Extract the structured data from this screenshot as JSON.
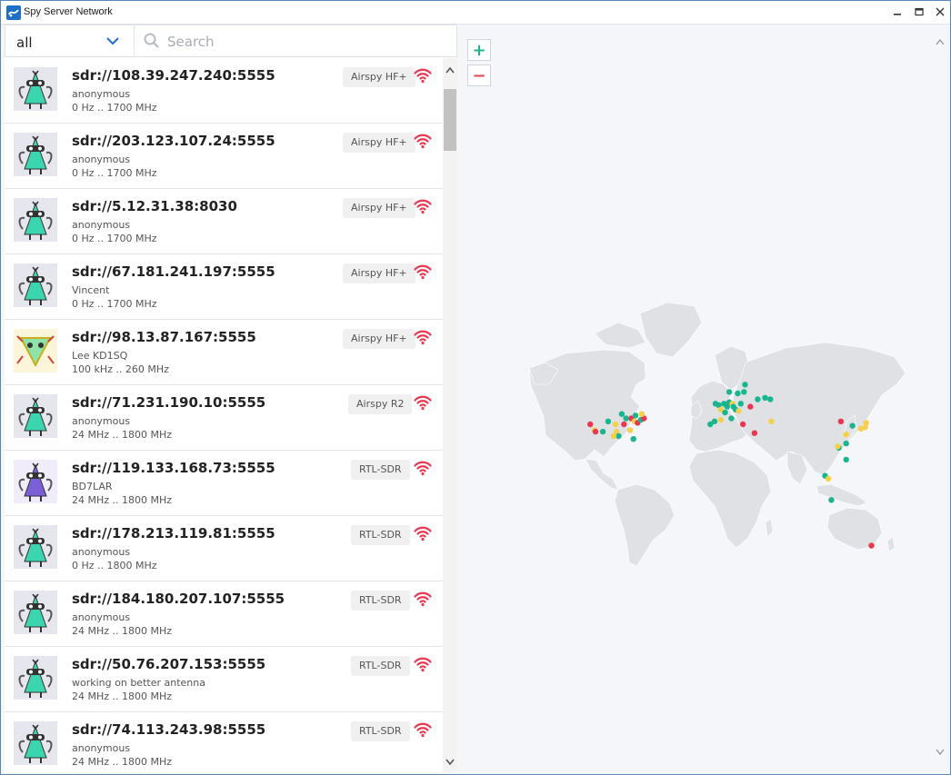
{
  "window": {
    "title": "Spy Server Network"
  },
  "filter": {
    "selected": "all",
    "search_placeholder": "Search",
    "search_value": ""
  },
  "colors": {
    "accent_teal": "#19b58e",
    "alert_red": "#e54855",
    "signal_red": "#e8384f",
    "yellow": "#f5d04a"
  },
  "servers": [
    {
      "address": "sdr://108.39.247.240:5555",
      "user": "anonymous",
      "range": "0 Hz .. 1700 MHz",
      "device": "Airspy HF+",
      "avatar": "robot-green"
    },
    {
      "address": "sdr://203.123.107.24:5555",
      "user": "anonymous",
      "range": "0 Hz .. 1700 MHz",
      "device": "Airspy HF+",
      "avatar": "robot-green"
    },
    {
      "address": "sdr://5.12.31.38:8030",
      "user": "anonymous",
      "range": "0 Hz .. 1700 MHz",
      "device": "Airspy HF+",
      "avatar": "robot-green"
    },
    {
      "address": "sdr://67.181.241.197:5555",
      "user": "Vincent",
      "range": "0 Hz .. 1700 MHz",
      "device": "Airspy HF+",
      "avatar": "robot-green"
    },
    {
      "address": "sdr://98.13.87.167:5555",
      "user": "Lee KD1SQ",
      "range": "100 kHz .. 260 MHz",
      "device": "Airspy HF+",
      "avatar": "triangle-yellow"
    },
    {
      "address": "sdr://71.231.190.10:5555",
      "user": "anonymous",
      "range": "24 MHz .. 1800 MHz",
      "device": "Airspy R2",
      "avatar": "robot-green"
    },
    {
      "address": "sdr://119.133.168.73:5555",
      "user": "BD7LAR",
      "range": "24 MHz .. 1800 MHz",
      "device": "RTL-SDR",
      "avatar": "robot-purple"
    },
    {
      "address": "sdr://178.213.119.81:5555",
      "user": "anonymous",
      "range": "0 Hz .. 1800 MHz",
      "device": "RTL-SDR",
      "avatar": "robot-green"
    },
    {
      "address": "sdr://184.180.207.107:5555",
      "user": "anonymous",
      "range": "24 MHz .. 1800 MHz",
      "device": "RTL-SDR",
      "avatar": "robot-green"
    },
    {
      "address": "sdr://50.76.207.153:5555",
      "user": "working on better antenna",
      "range": "24 MHz .. 1800 MHz",
      "device": "RTL-SDR",
      "avatar": "robot-green"
    },
    {
      "address": "sdr://74.113.243.98:5555",
      "user": "anonymous",
      "range": "24 MHz .. 1800 MHz",
      "device": "RTL-SDR",
      "avatar": "robot-green"
    }
  ],
  "map": {
    "zoom_in": "+",
    "zoom_out": "−",
    "markers": [
      {
        "lon": -122,
        "lat": 38,
        "c": "red"
      },
      {
        "lon": -118,
        "lat": 34,
        "c": "yellow"
      },
      {
        "lon": -117,
        "lat": 33,
        "c": "red"
      },
      {
        "lon": -110,
        "lat": 33,
        "c": "teal"
      },
      {
        "lon": -105,
        "lat": 40,
        "c": "teal"
      },
      {
        "lon": -97,
        "lat": 33,
        "c": "yellow"
      },
      {
        "lon": -95,
        "lat": 30,
        "c": "teal"
      },
      {
        "lon": -98,
        "lat": 38,
        "c": "yellow"
      },
      {
        "lon": -90,
        "lat": 38,
        "c": "red"
      },
      {
        "lon": -88,
        "lat": 42,
        "c": "teal"
      },
      {
        "lon": -84,
        "lat": 34,
        "c": "yellow"
      },
      {
        "lon": -83,
        "lat": 42,
        "c": "red"
      },
      {
        "lon": -80,
        "lat": 40,
        "c": "yellow"
      },
      {
        "lon": -77,
        "lat": 39,
        "c": "red"
      },
      {
        "lon": -74,
        "lat": 41,
        "c": "teal"
      },
      {
        "lon": -71,
        "lat": 42,
        "c": "red"
      },
      {
        "lon": -73,
        "lat": 45,
        "c": "yellow"
      },
      {
        "lon": -79,
        "lat": 44,
        "c": "teal"
      },
      {
        "lon": -92,
        "lat": 45,
        "c": "teal"
      },
      {
        "lon": -100,
        "lat": 30,
        "c": "yellow"
      },
      {
        "lon": -81,
        "lat": 28,
        "c": "teal"
      },
      {
        "lon": -3,
        "lat": 52,
        "c": "teal"
      },
      {
        "lon": 0,
        "lat": 51,
        "c": "teal"
      },
      {
        "lon": -4,
        "lat": 40,
        "c": "teal"
      },
      {
        "lon": 2,
        "lat": 48,
        "c": "yellow"
      },
      {
        "lon": 5,
        "lat": 52,
        "c": "teal"
      },
      {
        "lon": 8,
        "lat": 50,
        "c": "teal"
      },
      {
        "lon": 10,
        "lat": 53,
        "c": "teal"
      },
      {
        "lon": 13,
        "lat": 52,
        "c": "yellow"
      },
      {
        "lon": 14,
        "lat": 50,
        "c": "teal"
      },
      {
        "lon": 16,
        "lat": 48,
        "c": "teal"
      },
      {
        "lon": 19,
        "lat": 47,
        "c": "yellow"
      },
      {
        "lon": 21,
        "lat": 52,
        "c": "teal"
      },
      {
        "lon": 12,
        "lat": 42,
        "c": "teal"
      },
      {
        "lon": 23,
        "lat": 38,
        "c": "red"
      },
      {
        "lon": 18,
        "lat": 59,
        "c": "teal"
      },
      {
        "lon": 24,
        "lat": 60,
        "c": "teal"
      },
      {
        "lon": 10,
        "lat": 60,
        "c": "teal"
      },
      {
        "lon": 25,
        "lat": 65,
        "c": "teal"
      },
      {
        "lon": 30,
        "lat": 50,
        "c": "red"
      },
      {
        "lon": 37,
        "lat": 55,
        "c": "teal"
      },
      {
        "lon": 49,
        "lat": 55,
        "c": "teal"
      },
      {
        "lon": 44,
        "lat": 56,
        "c": "teal"
      },
      {
        "lon": 6,
        "lat": 46,
        "c": "teal"
      },
      {
        "lon": -8,
        "lat": 38,
        "c": "teal"
      },
      {
        "lon": 34,
        "lat": 32,
        "c": "red"
      },
      {
        "lon": 50,
        "lat": 40,
        "c": "yellow"
      },
      {
        "lon": 2,
        "lat": 41,
        "c": "yellow"
      },
      {
        "lon": 116,
        "lat": 40,
        "c": "red"
      },
      {
        "lon": 121,
        "lat": 31,
        "c": "yellow"
      },
      {
        "lon": 114,
        "lat": 22,
        "c": "teal"
      },
      {
        "lon": 113,
        "lat": 23,
        "c": "yellow"
      },
      {
        "lon": 127,
        "lat": 37,
        "c": "teal"
      },
      {
        "lon": 135,
        "lat": 35,
        "c": "yellow"
      },
      {
        "lon": 139,
        "lat": 36,
        "c": "yellow"
      },
      {
        "lon": 140,
        "lat": 39,
        "c": "yellow"
      },
      {
        "lon": 121,
        "lat": 25,
        "c": "teal"
      },
      {
        "lon": 101,
        "lat": 3,
        "c": "teal"
      },
      {
        "lon": 104,
        "lat": 1,
        "c": "yellow"
      },
      {
        "lon": 107,
        "lat": -6,
        "c": "teal"
      },
      {
        "lon": 121,
        "lat": 14,
        "c": "teal"
      },
      {
        "lon": 145,
        "lat": -37,
        "c": "red"
      }
    ]
  }
}
